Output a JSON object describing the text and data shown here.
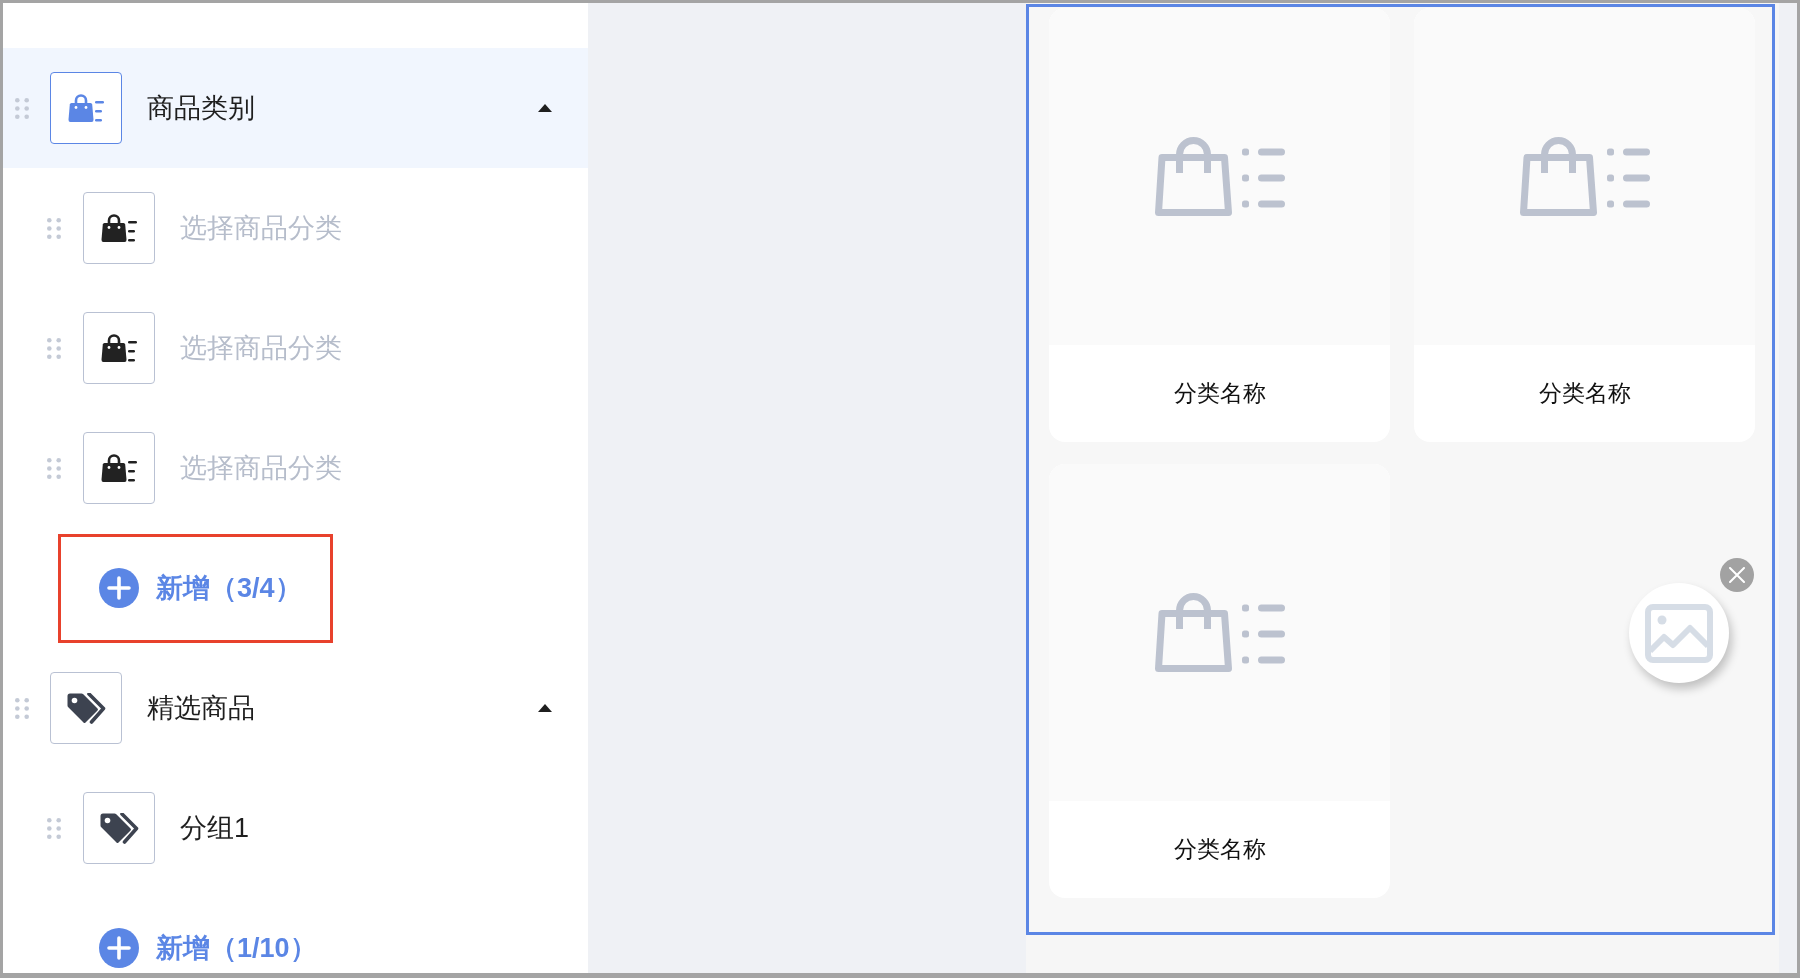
{
  "sidebar": {
    "groups": [
      {
        "kind": "category",
        "title": "商品类别",
        "selected": true,
        "expanded": true,
        "items": [
          {
            "placeholder": "选择商品分类"
          },
          {
            "placeholder": "选择商品分类"
          },
          {
            "placeholder": "选择商品分类"
          }
        ],
        "add_button": {
          "label": "新增（3/4）",
          "highlighted": true
        }
      },
      {
        "kind": "goods",
        "title": "精选商品",
        "selected": false,
        "expanded": true,
        "items": [
          {
            "value": "分组1"
          }
        ],
        "add_button": {
          "label": "新增（1/10）",
          "highlighted": false
        }
      }
    ]
  },
  "preview": {
    "selected": true,
    "cards": [
      {
        "label": "分类名称"
      },
      {
        "label": "分类名称"
      },
      {
        "label": "分类名称"
      }
    ],
    "image_upload": {
      "removable": true
    }
  }
}
